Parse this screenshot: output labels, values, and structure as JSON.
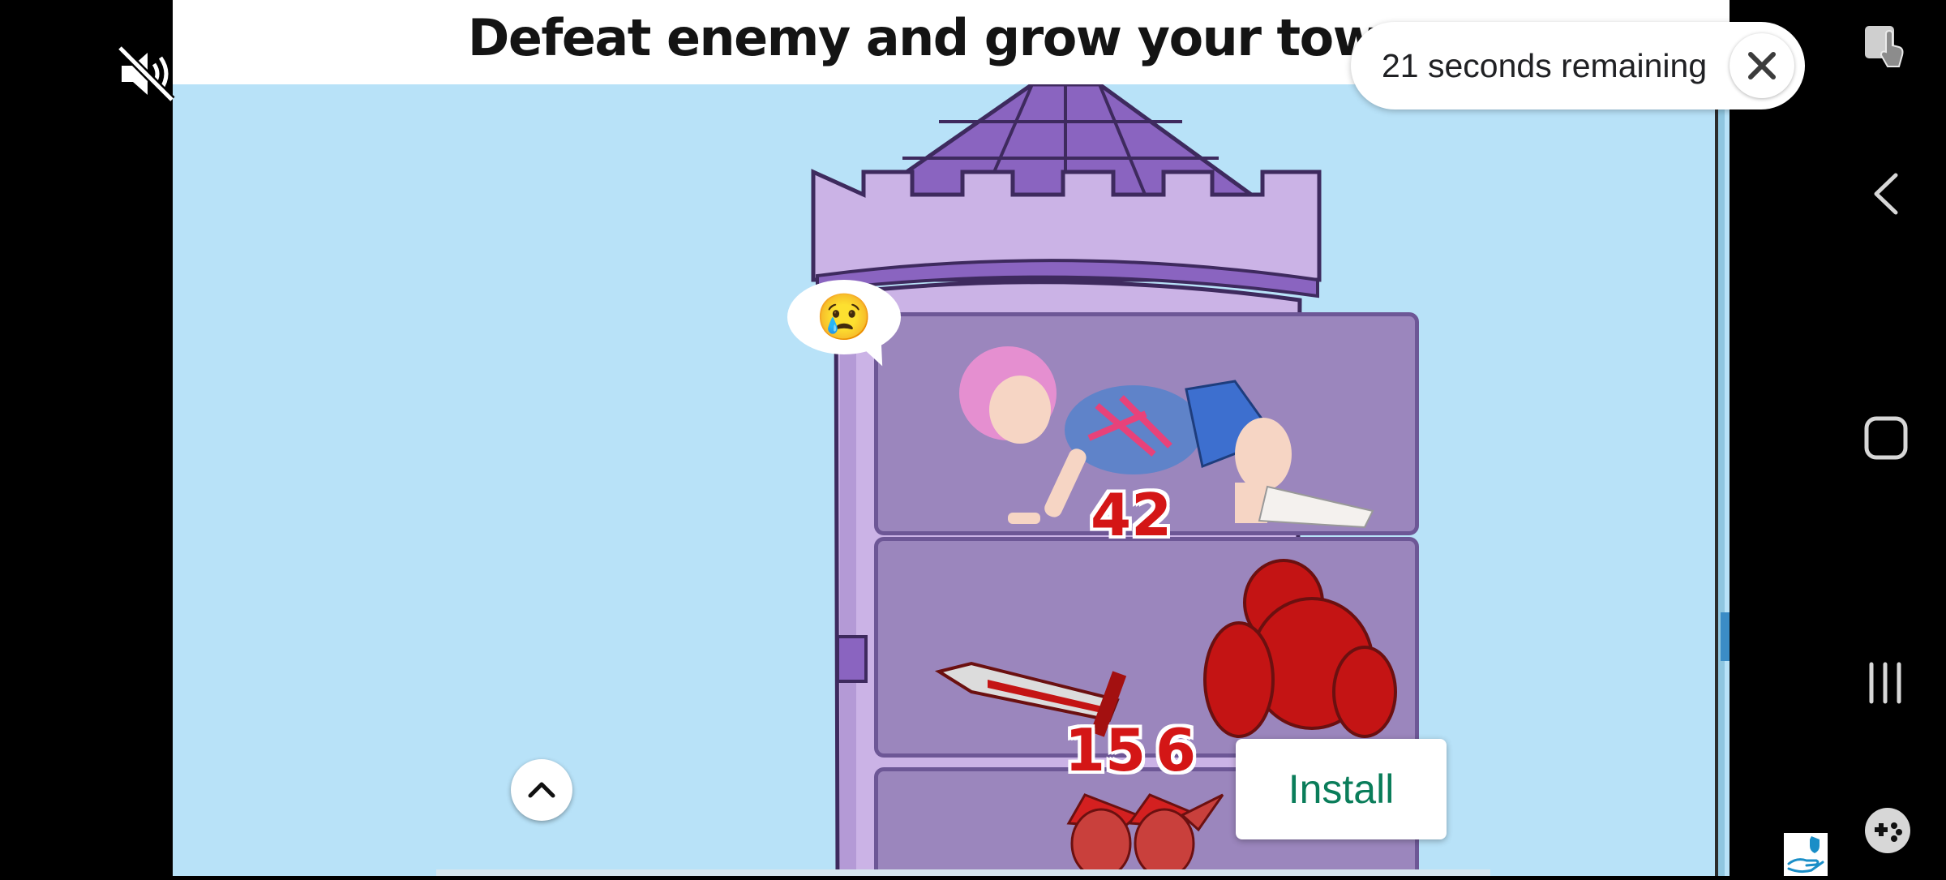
{
  "ad": {
    "headline": "Defeat enemy and grow your tower",
    "speech_emoji": "😢",
    "hero_power": "42",
    "enemy_powers": [
      "15",
      "6"
    ],
    "install_label": "Install"
  },
  "timer": {
    "text": "21 seconds remaining"
  },
  "icons": {
    "mute": "volume-muted-icon",
    "close": "close-icon",
    "collapse": "chevron-up-icon",
    "back": "back-chevron-icon",
    "home": "home-square-icon",
    "recents": "recents-bars-icon",
    "game": "game-controller-icon",
    "screenshot": "screenshot-touch-icon",
    "badge": "shield-hand-icon"
  },
  "colors": {
    "sky": "#b8e2f8",
    "tower": "#cbb3e6",
    "roof": "#8a64c0",
    "enemy": "#c41414",
    "install_text": "#0a7d5a"
  }
}
